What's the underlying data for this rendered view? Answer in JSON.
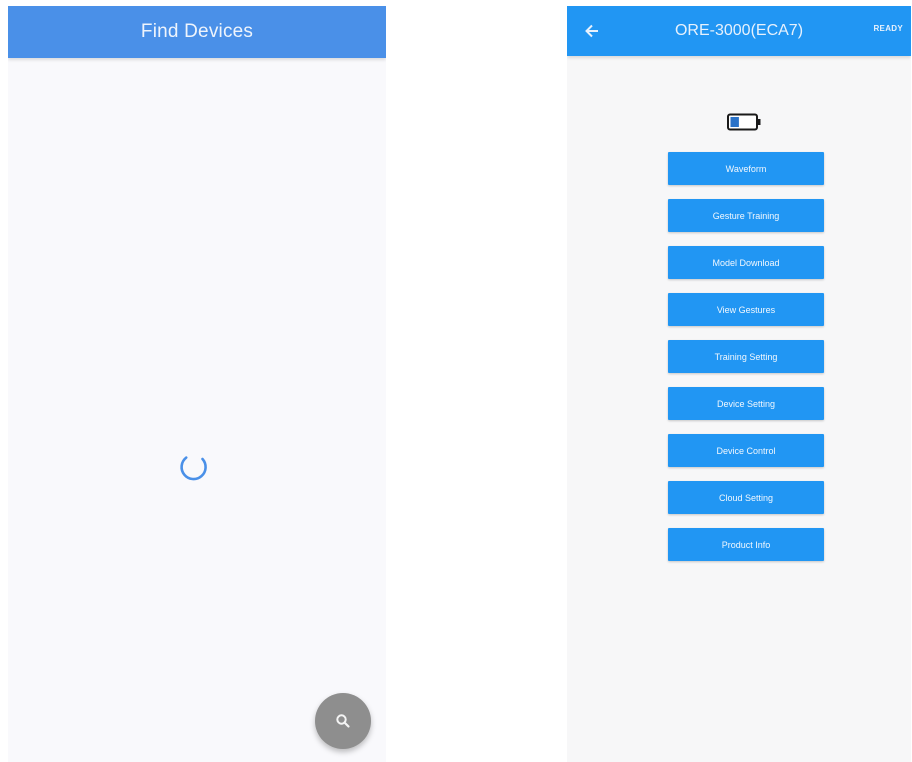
{
  "left_screen": {
    "title": "Find Devices",
    "loading": true,
    "fab_icon": "search-icon",
    "colors": {
      "appbar": "#4a90e8",
      "fab": "#8e8e8e",
      "spinner": "#4a90e8"
    }
  },
  "right_screen": {
    "title": "ORE-3000(ECA7)",
    "back_icon": "arrow-left-icon",
    "action_label": "READY",
    "battery_icon": "battery-icon",
    "battery_level": 0.35,
    "menu_items": [
      {
        "label": "Waveform"
      },
      {
        "label": "Gesture Training"
      },
      {
        "label": "Model Download"
      },
      {
        "label": "View Gestures"
      },
      {
        "label": "Training Setting"
      },
      {
        "label": "Device Setting"
      },
      {
        "label": "Device Control"
      },
      {
        "label": "Cloud Setting"
      },
      {
        "label": "Product Info"
      }
    ],
    "colors": {
      "appbar": "#2196f3",
      "button": "#2196f3"
    }
  }
}
